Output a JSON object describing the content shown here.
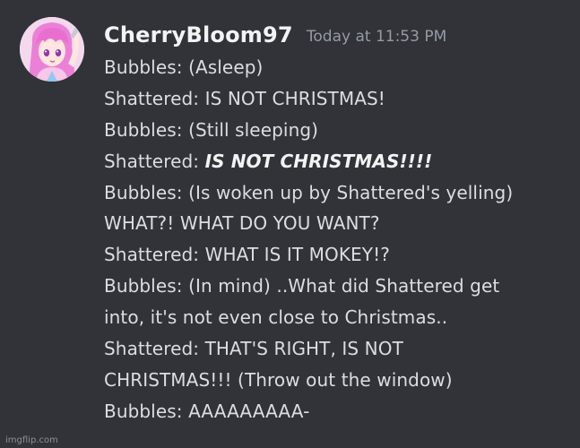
{
  "message": {
    "author": "CherryBloom97",
    "timestamp": "Today at 11:53 PM",
    "avatar_icon": "anime-avatar-pink-hair",
    "lines": [
      {
        "prefix": "Bubbles: (Asleep)",
        "emphasis": ""
      },
      {
        "prefix": "Shattered: IS NOT CHRISTMAS!",
        "emphasis": ""
      },
      {
        "prefix": "Bubbles: (Still sleeping)",
        "emphasis": ""
      },
      {
        "prefix": "Shattered: ",
        "emphasis": "IS NOT CHRISTMAS!!!!"
      },
      {
        "prefix": "Bubbles: (Is woken up by Shattered's yelling)",
        "emphasis": ""
      },
      {
        "prefix": "WHAT?! WHAT DO YOU WANT?",
        "emphasis": ""
      },
      {
        "prefix": "Shattered: WHAT IS IT MOKEY!?",
        "emphasis": ""
      },
      {
        "prefix": "Bubbles: (In mind) ..What did Shattered get",
        "emphasis": ""
      },
      {
        "prefix": "into, it's not even close to Christmas..",
        "emphasis": ""
      },
      {
        "prefix": "Shattered: THAT'S RIGHT, IS NOT",
        "emphasis": ""
      },
      {
        "prefix": "CHRISTMAS!!! (Throw out the window)",
        "emphasis": ""
      },
      {
        "prefix": "Bubbles: AAAAAAAAA-",
        "emphasis": ""
      }
    ]
  },
  "watermark": "imgflip.com",
  "colors": {
    "background": "#313338",
    "username": "#f2f3f5",
    "timestamp": "#949ba4",
    "text": "#dbdee1"
  }
}
